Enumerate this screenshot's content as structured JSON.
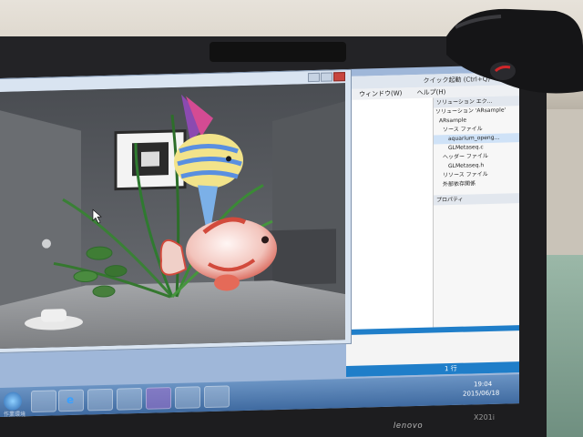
{
  "vs": {
    "title": "クイック起動 (Ctrl+Q)",
    "menu": [
      "ウィンドウ(W)",
      "ヘルプ(H)"
    ],
    "solution_header": "ソリューション エク...",
    "solution_items": [
      "ソリューション 'ARsample'",
      "ARsample",
      "ソース ファイル",
      "aquarium_openg...",
      "GLMetaseq.c",
      "ヘッダー ファイル",
      "GLMetaseq.h",
      "リソース ファイル",
      "外部依存関係"
    ],
    "properties_header": "プロパティ",
    "status_text": "1 行"
  },
  "taskbar": {
    "start_label": "作業環境",
    "time": "19:04",
    "date": "2015/06/18",
    "buttons": [
      "explorer",
      "ie",
      "folder",
      "media",
      "visual-studio",
      "monitor",
      "app"
    ]
  },
  "laptop": {
    "brand": "lenovo",
    "model": "X201i"
  },
  "colors": {
    "accent": "#1f7ec9",
    "taskbar": "#3f6aa0",
    "close": "#c8463f"
  }
}
